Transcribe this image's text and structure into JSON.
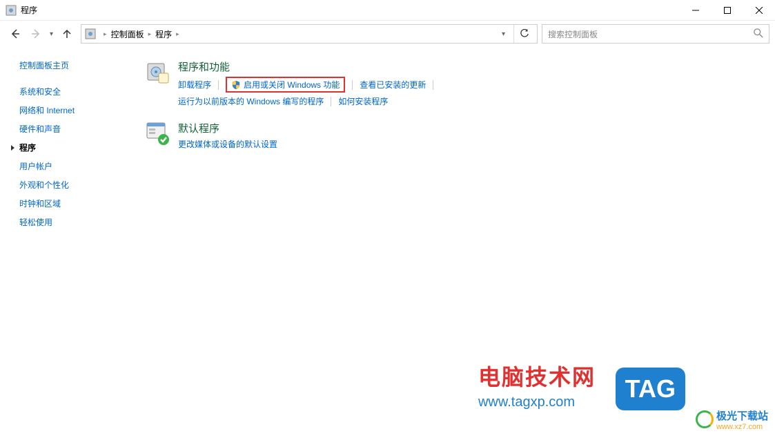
{
  "window": {
    "title": "程序"
  },
  "breadcrumb": {
    "root": "控制面板",
    "current": "程序"
  },
  "search": {
    "placeholder": "搜索控制面板"
  },
  "sidebar": {
    "home": "控制面板主页",
    "items": [
      {
        "label": "系统和安全",
        "current": false
      },
      {
        "label": "网络和 Internet",
        "current": false
      },
      {
        "label": "硬件和声音",
        "current": false
      },
      {
        "label": "程序",
        "current": true
      },
      {
        "label": "用户帐户",
        "current": false
      },
      {
        "label": "外观和个性化",
        "current": false
      },
      {
        "label": "时钟和区域",
        "current": false
      },
      {
        "label": "轻松使用",
        "current": false
      }
    ]
  },
  "categories": [
    {
      "title": "程序和功能",
      "icon": "programs",
      "links": [
        {
          "label": "卸载程序",
          "shield": false,
          "highlight": false
        },
        {
          "label": "启用或关闭 Windows 功能",
          "shield": true,
          "highlight": true
        },
        {
          "label": "查看已安装的更新",
          "shield": false,
          "highlight": false
        },
        {
          "label": "运行为以前版本的 Windows 编写的程序",
          "shield": false,
          "highlight": false
        },
        {
          "label": "如何安装程序",
          "shield": false,
          "highlight": false
        }
      ]
    },
    {
      "title": "默认程序",
      "icon": "defaults",
      "links": [
        {
          "label": "更改媒体或设备的默认设置",
          "shield": false,
          "highlight": false
        }
      ]
    }
  ],
  "watermarks": {
    "w1_line1": "电脑技术网",
    "w1_line2": "www.tagxp.com",
    "tag": "TAG",
    "w2_line1": "极光下载站",
    "w2_line2": "www.xz7.com"
  }
}
